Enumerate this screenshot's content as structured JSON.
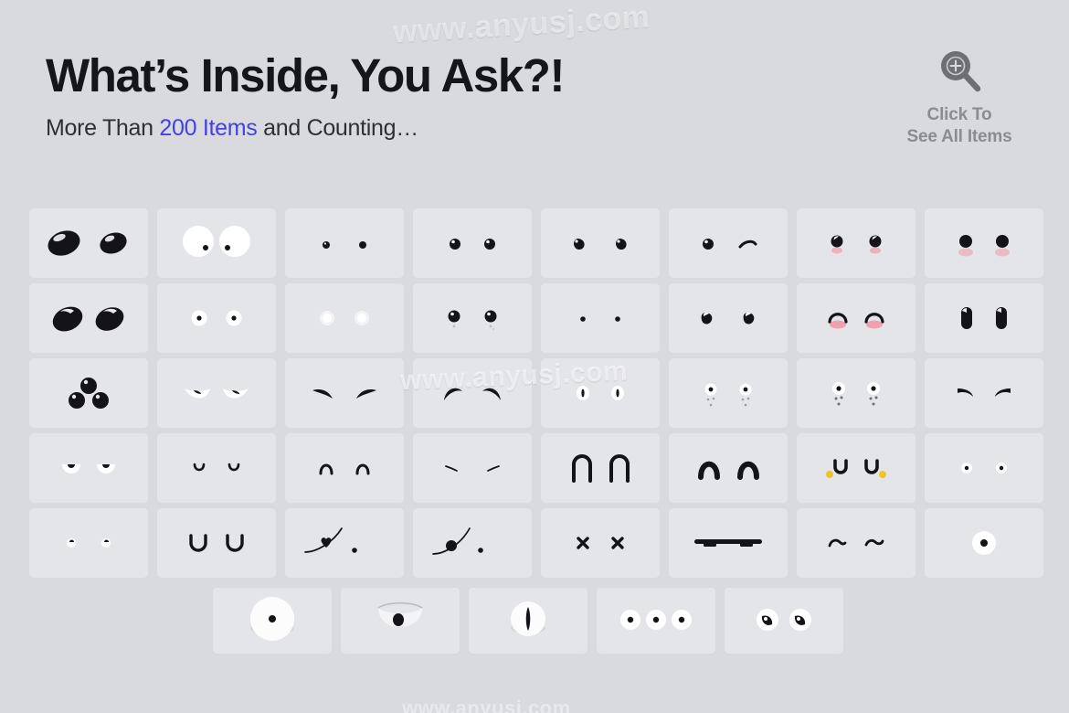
{
  "page": {
    "background_color": "#d9dade",
    "tile_color": "#e4e5e9"
  },
  "watermark": {
    "top": "www.anyusj.com",
    "middle": "www.anyusj.com",
    "bottom": "www.anyusj.com"
  },
  "header": {
    "title": "What’s Inside, You Ask?!",
    "subtitle_prefix": "More Than ",
    "subtitle_accent": "200 Items",
    "subtitle_suffix": " and Counting…",
    "accent_color": "#4340e8"
  },
  "see_all": {
    "icon": "magnifier-plus-icon",
    "line1": "Click To",
    "line2": "See All Items",
    "text_color": "#8b8c92"
  },
  "grid": {
    "columns": 8,
    "rows": 5,
    "total_tiles": 40,
    "tiles": [
      {
        "id": 1,
        "name": "big-oval-glossy-eyes"
      },
      {
        "id": 2,
        "name": "white-round-eyes-tiny-pupils"
      },
      {
        "id": 3,
        "name": "tiny-dot-eyes"
      },
      {
        "id": 4,
        "name": "small-round-eyes-highlight"
      },
      {
        "id": 5,
        "name": "teardrop-eyes-left-tilt"
      },
      {
        "id": 6,
        "name": "dot-and-wink-eyes"
      },
      {
        "id": 7,
        "name": "dot-eyes-pink-blush"
      },
      {
        "id": 8,
        "name": "round-eyes-pink-blush"
      },
      {
        "id": 9,
        "name": "large-tilted-bean-eyes"
      },
      {
        "id": 10,
        "name": "white-ring-eyes-dot-center"
      },
      {
        "id": 11,
        "name": "soft-white-glow-dots"
      },
      {
        "id": 12,
        "name": "round-eyes-with-sparkle"
      },
      {
        "id": 13,
        "name": "micro-dot-eyes"
      },
      {
        "id": 14,
        "name": "comma-shaped-eyes"
      },
      {
        "id": 15,
        "name": "happy-arc-eyes-blush"
      },
      {
        "id": 16,
        "name": "vertical-capsule-eyes"
      },
      {
        "id": 17,
        "name": "three-black-spheres"
      },
      {
        "id": 18,
        "name": "sleepy-half-lid-eyes"
      },
      {
        "id": 19,
        "name": "angry-brow-curve-eyes"
      },
      {
        "id": 20,
        "name": "arched-brow-eyes"
      },
      {
        "id": 21,
        "name": "narrow-vertical-slit-eyes"
      },
      {
        "id": 22,
        "name": "dot-eyes-with-freckles"
      },
      {
        "id": 23,
        "name": "dot-eyes-with-sparkle-dots"
      },
      {
        "id": 24,
        "name": "thick-slanted-brow-eyes"
      },
      {
        "id": 25,
        "name": "half-moon-white-eyes"
      },
      {
        "id": 26,
        "name": "small-u-curve-eyes"
      },
      {
        "id": 27,
        "name": "small-n-arch-eyes"
      },
      {
        "id": 28,
        "name": "thin-dash-eyes"
      },
      {
        "id": 29,
        "name": "tall-thin-arch-eyes"
      },
      {
        "id": 30,
        "name": "bold-arch-eyes"
      },
      {
        "id": 31,
        "name": "u-shape-eyes-yellow-dots"
      },
      {
        "id": 32,
        "name": "white-circle-eyes-pupils"
      },
      {
        "id": 33,
        "name": "tiny-white-dot-eyes"
      },
      {
        "id": 34,
        "name": "u-bowl-eyes"
      },
      {
        "id": 35,
        "name": "heart-swoosh-and-dot"
      },
      {
        "id": 36,
        "name": "dot-swoosh-and-dot"
      },
      {
        "id": 37,
        "name": "x-cross-eyes"
      },
      {
        "id": 38,
        "name": "flat-bar-unibrow"
      },
      {
        "id": 39,
        "name": "squiggle-wave-eyes"
      },
      {
        "id": 40,
        "name": "single-cyclops-eye"
      }
    ]
  },
  "strip": {
    "columns": 5,
    "tiles": [
      {
        "id": 41,
        "name": "large-3d-eyeball-plain"
      },
      {
        "id": 42,
        "name": "large-3d-eyeball-droopy-lid"
      },
      {
        "id": 43,
        "name": "large-3d-eyeball-slit-pupil"
      },
      {
        "id": 44,
        "name": "three-small-eyeballs"
      },
      {
        "id": 45,
        "name": "two-crescent-pupil-eyeballs"
      }
    ]
  },
  "colors": {
    "black": "#141418",
    "white": "#ffffff",
    "blush": "#f0a0ae",
    "yellow": "#f2c22c"
  }
}
